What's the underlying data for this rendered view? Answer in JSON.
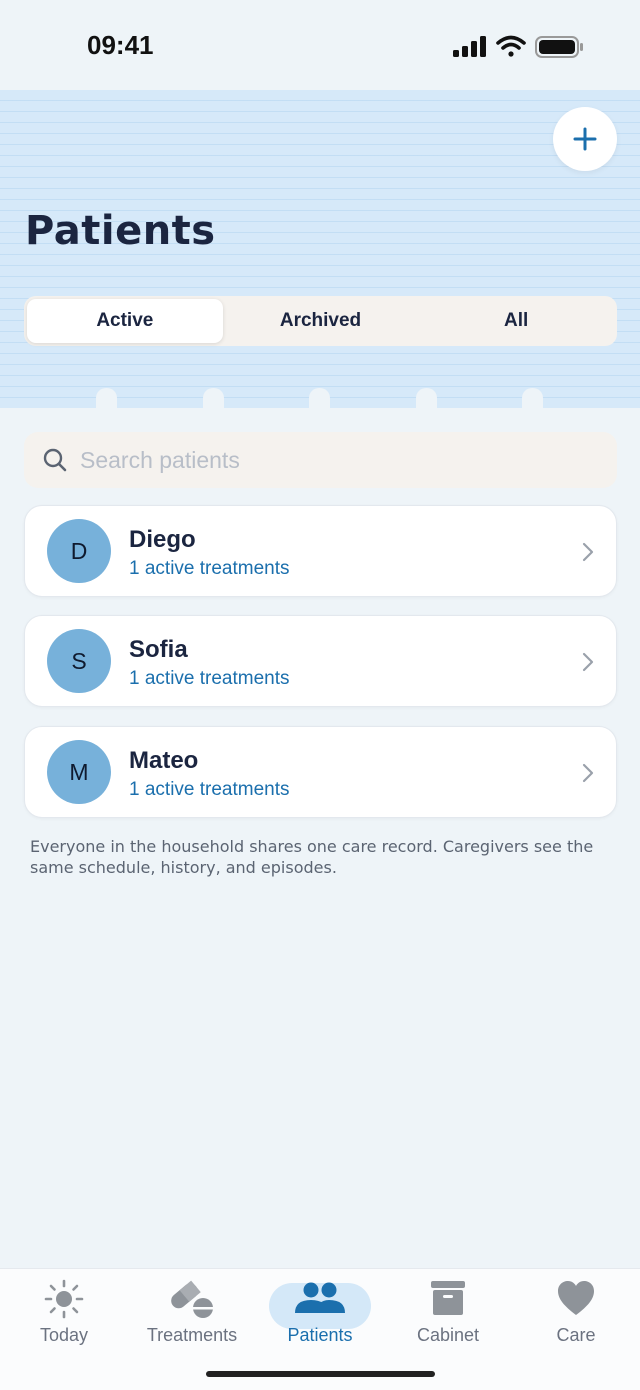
{
  "status_bar": {
    "time": "09:41"
  },
  "header": {
    "title": "Patients",
    "segments": [
      {
        "label": "Active",
        "selected": true
      },
      {
        "label": "Archived",
        "selected": false
      },
      {
        "label": "All",
        "selected": false
      }
    ]
  },
  "search": {
    "placeholder": "Search patients"
  },
  "patients": [
    {
      "initial": "D",
      "name": "Diego",
      "subtitle": "1 active treatments"
    },
    {
      "initial": "S",
      "name": "Sofia",
      "subtitle": "1 active treatments"
    },
    {
      "initial": "M",
      "name": "Mateo",
      "subtitle": "1 active treatments"
    }
  ],
  "footnote": "Everyone in the household shares one care record. Caregivers see the same schedule, history, and episodes.",
  "tab_bar": {
    "items": [
      {
        "label": "Today",
        "icon": "sun-icon",
        "active": false
      },
      {
        "label": "Treatments",
        "icon": "pills-icon",
        "active": false
      },
      {
        "label": "Patients",
        "icon": "people-icon",
        "active": true
      },
      {
        "label": "Cabinet",
        "icon": "archive-box-icon",
        "active": false
      },
      {
        "label": "Care",
        "icon": "heart-icon",
        "active": false
      }
    ]
  },
  "colors": {
    "accent": "#1b6fad",
    "header_bg": "#d6e9f9",
    "avatar_bg": "#77b1da",
    "page_bg": "#eef4f8"
  }
}
